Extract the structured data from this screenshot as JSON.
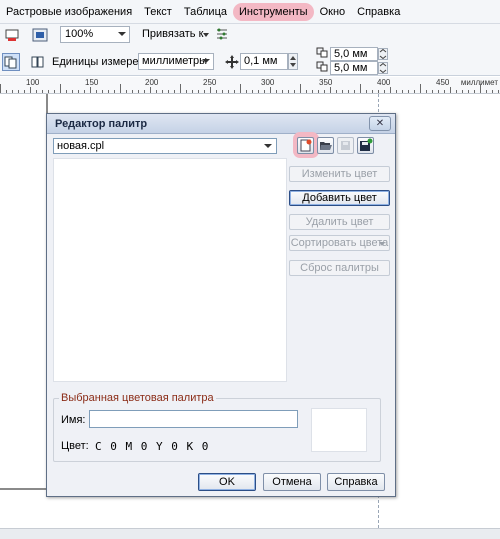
{
  "menu": {
    "items": [
      "Растровые изображения",
      "Текст",
      "Таблица",
      "Инструменты",
      "Окно",
      "Справка"
    ]
  },
  "toolbar": {
    "zoom": "100%",
    "snap_label": "Привязать к",
    "units_label": "Единицы измерения:",
    "units_value": "миллиметры",
    "nudge_value": "0,1 мм",
    "dup_x": "5,0 мм",
    "dup_y": "5,0 мм"
  },
  "ruler": {
    "ticks": [
      "100",
      "150",
      "200",
      "250",
      "300",
      "350",
      "400",
      "450"
    ],
    "unit": "миллимет"
  },
  "dialog": {
    "title": "Редактор палитр",
    "palette_file": "новая.cpl",
    "buttons": {
      "change_color": "Изменить цвет",
      "add_color": "Добавить цвет",
      "delete_color": "Удалить цвет",
      "sort_colors": "Сортировать цвета",
      "reset_palette": "Сброс палитры"
    },
    "selected_group_title": "Выбранная цветовая палитра",
    "name_label": "Имя:",
    "name_value": "",
    "color_label": "Цвет:",
    "color_value": "C 0   M 0   Y 0   K 0",
    "swatch_color": "#ffffff",
    "ok": "OK",
    "cancel": "Отмена",
    "help": "Справка"
  },
  "colors": {
    "highlight": "#f3b8c4",
    "group_title": "#8b2c17"
  }
}
